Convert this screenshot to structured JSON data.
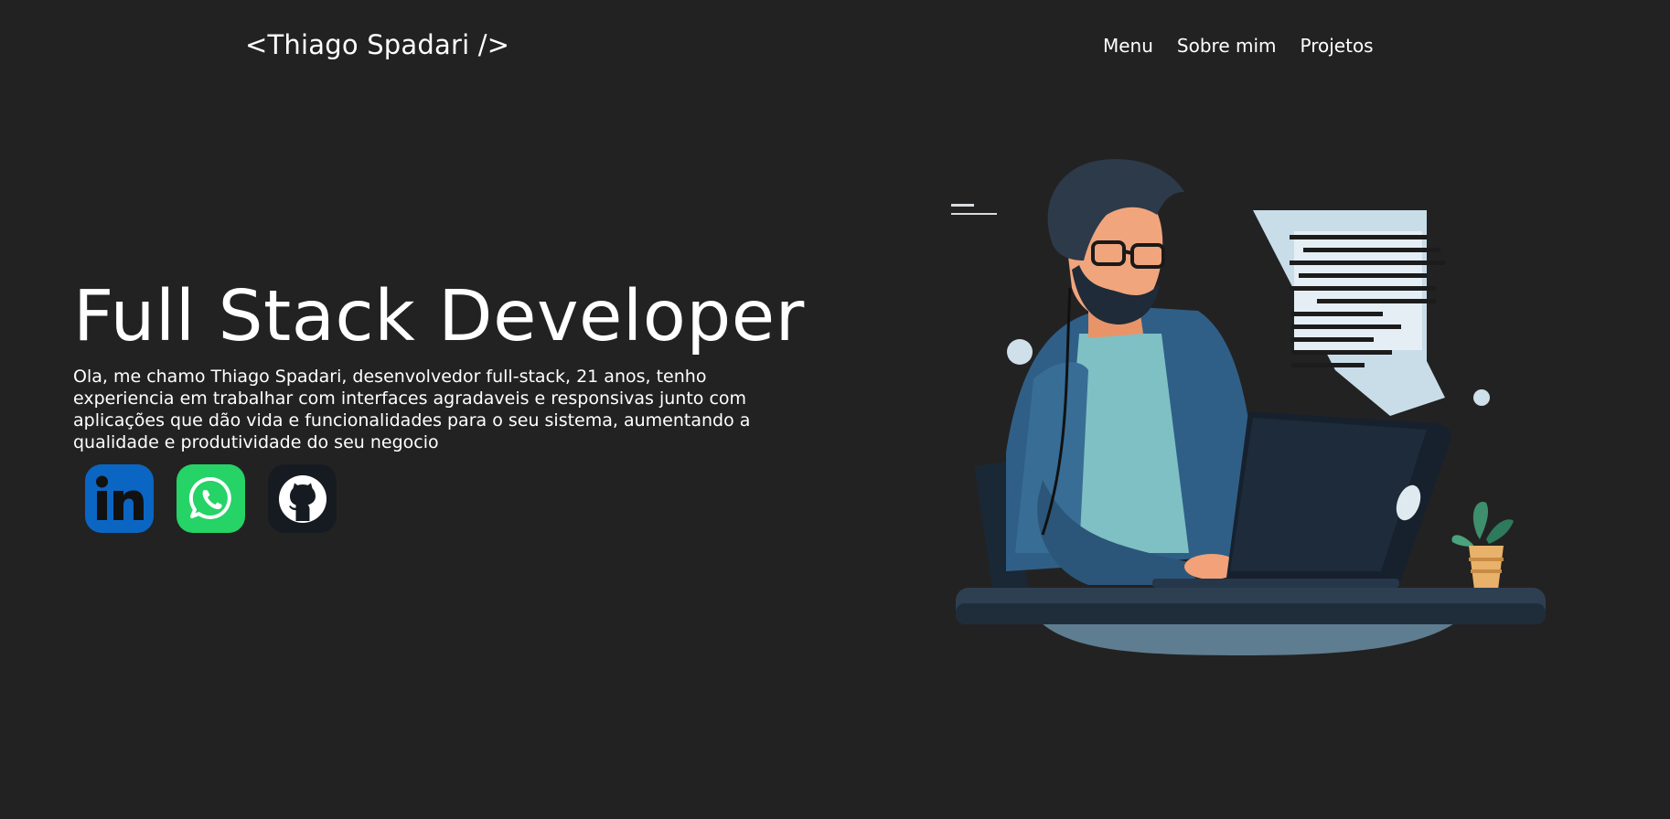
{
  "header": {
    "logo": "<Thiago Spadari />",
    "nav": [
      "Menu",
      "Sobre mim",
      "Projetos"
    ]
  },
  "hero": {
    "title": "Full Stack Developer",
    "description": "Ola, me chamo Thiago Spadari, desenvolvedor full-stack, 21 anos, tenho experiencia em trabalhar com interfaces agradaveis e responsivas junto com aplicações que dão vida e funcionalidades para o seu sistema, aumentando a qualidade e produtividade do seu negocio"
  },
  "socials": [
    {
      "icon": "linkedin-icon",
      "color": "#0a66c2"
    },
    {
      "icon": "whatsapp-icon",
      "color": "#25d366"
    },
    {
      "icon": "github-icon",
      "color": "#161b22"
    }
  ],
  "colors": {
    "background": "#232222",
    "text": "#ffffff"
  }
}
